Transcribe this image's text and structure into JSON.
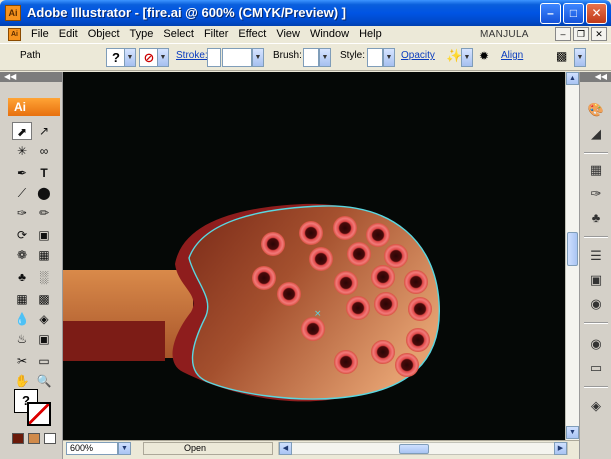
{
  "window": {
    "title": "Adobe Illustrator - [fire.ai @ 600% (CMYK/Preview) ]",
    "app_icon": "Ai",
    "controls": [
      "minimize",
      "maximize",
      "close"
    ]
  },
  "menubar": {
    "items": [
      "File",
      "Edit",
      "Object",
      "Type",
      "Select",
      "Filter",
      "Effect",
      "View",
      "Window",
      "Help"
    ],
    "user": "MANJULA"
  },
  "controlbar": {
    "selection_label": "Path",
    "stroke_label": "Stroke:",
    "brush_label": "Brush:",
    "style_label": "Style:",
    "opacity_label": "Opacity",
    "align_label": "Align",
    "fill_indicator": "?"
  },
  "toolpanel": {
    "logo": "Ai",
    "fill_indicator": "?",
    "tools": [
      "selection-tool",
      "direct-selection-tool",
      "magic-wand-tool",
      "lasso-tool",
      "pen-tool",
      "type-tool",
      "line-tool",
      "ellipse-tool",
      "paintbrush-tool",
      "pencil-tool",
      "rotate-tool",
      "scale-tool",
      "warp-tool",
      "free-transform-tool",
      "symbol-sprayer-tool",
      "graph-tool",
      "mesh-tool",
      "gradient-tool",
      "eyedropper-tool",
      "blend-tool",
      "live-paint-bucket-tool",
      "live-paint-selection-tool",
      "scissors-tool",
      "eraser-tool",
      "hand-tool",
      "zoom-tool"
    ]
  },
  "statusbar": {
    "zoom": "600%",
    "status": "Open"
  },
  "canvas": {
    "background": "#050806",
    "spoon_outline": "#5ad7e0",
    "shadow_color": "#8e1d1d",
    "handle_color": "#c8703a",
    "dot_outer": "#f06a6a",
    "dot_inner": "#4a0a0a"
  },
  "dock": {
    "panels": [
      "color-panel",
      "gradient-panel",
      "swatches-panel",
      "brushes-panel",
      "symbols-panel",
      "stroke-panel",
      "transparency-panel",
      "appearance-panel",
      "graphic-styles-panel",
      "layers-panel"
    ]
  }
}
